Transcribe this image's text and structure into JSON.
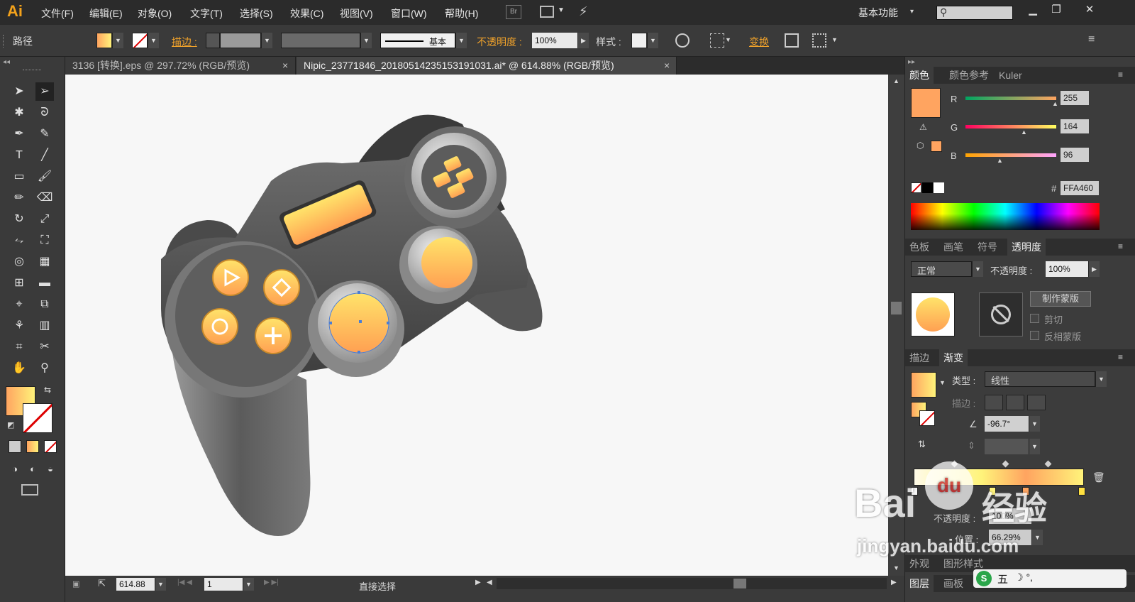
{
  "menubar": {
    "logo": "Ai",
    "items": [
      "文件(F)",
      "编辑(E)",
      "对象(O)",
      "文字(T)",
      "选择(S)",
      "效果(C)",
      "视图(V)",
      "窗口(W)",
      "帮助(H)"
    ],
    "br": "Br",
    "workspace": "基本功能",
    "workspace_arrow": "▾",
    "search_icon": "⚲"
  },
  "controlbar": {
    "object_type": "路径",
    "stroke_label": "描边 :",
    "stroke_style": "基本",
    "opacity_label": "不透明度 :",
    "opacity_value": "100%",
    "style_label": "样式 :",
    "transform_label": "变换"
  },
  "tabs": [
    {
      "label": "3136 [转换].eps @ 297.72% (RGB/预览)",
      "close": "×"
    },
    {
      "label": "Nipic_23771846_20180514235153191031.ai* @ 614.88% (RGB/预览)",
      "close": "×"
    }
  ],
  "statusbar": {
    "zoom": "614.88",
    "artboard": "1",
    "tool_status": "直接选择"
  },
  "color_panel": {
    "tabs": [
      "颜色",
      "颜色参考",
      "Kuler"
    ],
    "r_label": "R",
    "r_value": "255",
    "g_label": "G",
    "g_value": "164",
    "b_label": "B",
    "b_value": "96",
    "hex_label": "#",
    "hex_value": "FFA460",
    "swatch": "#FFA460"
  },
  "transparency_panel": {
    "tabs": [
      "色板",
      "画笔",
      "符号",
      "透明度"
    ],
    "blend_mode": "正常",
    "opacity_label": "不透明度 :",
    "opacity_value": "100%",
    "make_mask": "制作蒙版",
    "clip": "剪切",
    "invert": "反相蒙版"
  },
  "gradient_panel": {
    "tabs": [
      "描边",
      "渐变"
    ],
    "type_label": "类型 :",
    "type_value": "线性",
    "stroke_label": "描边 :",
    "angle_value": "-96.7°",
    "opacity_label": "不透明度 :",
    "opacity_value": "100%",
    "location_label": "位置 :",
    "location_value": "66.29%"
  },
  "bottom_panels": {
    "appearance_tabs": [
      "外观",
      "图形样式"
    ],
    "layer_tabs": [
      "图层",
      "画板"
    ]
  },
  "watermark": {
    "brand": "Bai",
    "brand2": "经验",
    "paw": "du",
    "url": "jingyan.baidu.com"
  },
  "ime": {
    "label": "五",
    "icons": "☽ °,"
  }
}
